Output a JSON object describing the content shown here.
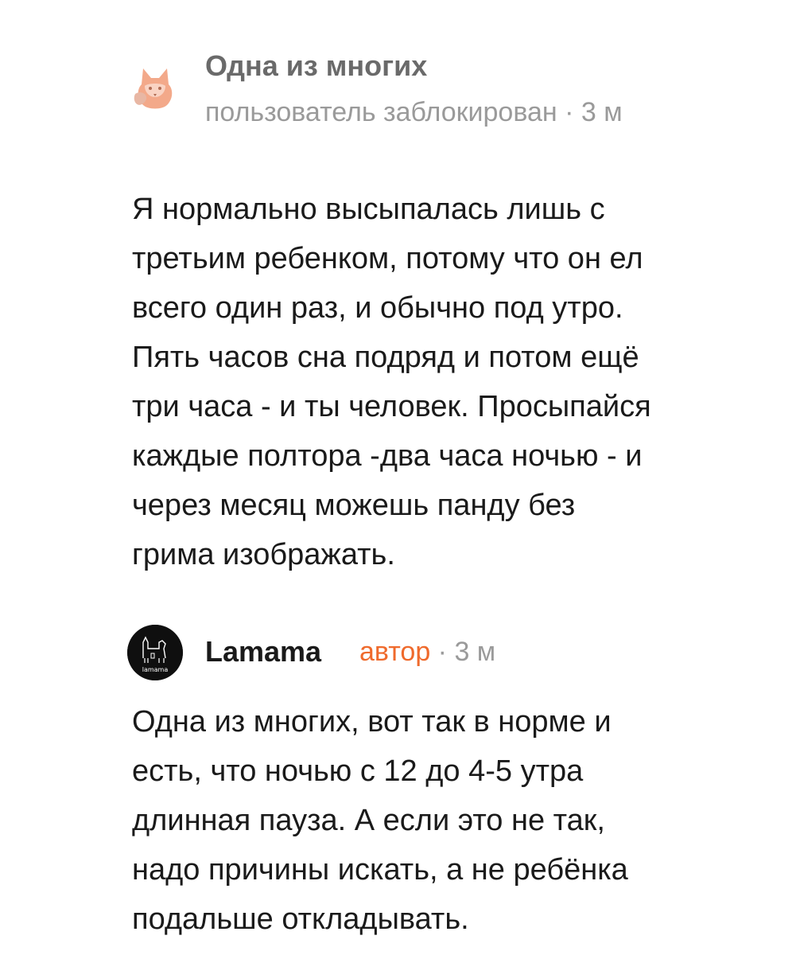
{
  "comments": [
    {
      "author": "Одна из многих",
      "meta": "пользователь заблокирован · 3 м",
      "avatar_icon": "fox-avatar-icon",
      "text_lines": [
        "Я нормально высыпалась лишь с",
        "третьим ребенком, потому что он ел",
        "всего один раз, и обычно под утро.",
        "Пять часов сна подряд и потом ещё",
        "три часа - и ты человек. Просыпайся",
        "каждые полтора -два часа ночью - и",
        "через месяц можешь панду без",
        "грима изображать."
      ]
    },
    {
      "author": "Lamama",
      "badge": "автор",
      "time": " · 3 м",
      "avatar_icon": "lamama-logo-avatar",
      "avatar_logo_text": "lamama",
      "text_lines": [
        "Одна из многих, вот так в норме и",
        "есть, что ночью с 12 до 4-5 утра",
        "длинная пауза. А если это не так,",
        "надо причины искать, а не ребёнка",
        "подальше откладывать."
      ]
    }
  ],
  "colors": {
    "accent_author_badge": "#ef6a2c",
    "muted_text": "#9a9a9a",
    "blocked_name": "#6a6a6a",
    "fox_orange": "#f3a98a"
  }
}
